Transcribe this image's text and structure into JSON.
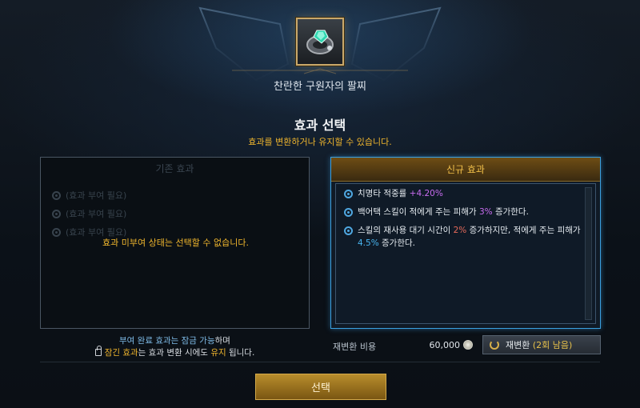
{
  "item": {
    "name": "찬란한 구원자의 팔찌",
    "icon": "bracelet-gem-icon"
  },
  "section": {
    "title": "효과 선택",
    "subtitle": "효과를 변환하거나 유지할 수 있습니다."
  },
  "left_panel": {
    "header": "기존 효과",
    "rows": [
      "(효과 부여 필요)",
      "(효과 부여 필요)",
      "(효과 부여 필요)"
    ],
    "notice": "효과 미부여 상태는 선택할 수 없습니다."
  },
  "right_panel": {
    "header": "신규 효과",
    "effects": [
      {
        "pre": "치명타 적중률 ",
        "val": "+4.20%",
        "post": "",
        "val2": "",
        "post2": ""
      },
      {
        "pre": "백어택 스킬이 적에게 주는 피해가 ",
        "val": "3%",
        "post": " 증가한다.",
        "val2": "",
        "post2": ""
      },
      {
        "pre": "스킬의 재사용 대기 시간이 ",
        "val": "2%",
        "post": " 증가하지만, 적에게 주는 피해가 ",
        "val2": "4.5%",
        "post2": " 증가한다."
      }
    ]
  },
  "info": {
    "line1_a": "부여 완료 효과는 잠금 가능",
    "line1_b": "하며",
    "line2_a": "잠긴 효과",
    "line2_b": "는 효과 변환 시에도 ",
    "line2_c": "유지",
    "line2_d": " 됩니다."
  },
  "cost": {
    "label": "재변환 비용",
    "value": "60,000"
  },
  "reroll": {
    "label": "재변환",
    "remaining": "(2회 남음)"
  },
  "select_button": "선택",
  "colors": {
    "gold": "#f0b62d",
    "accent_blue": "#3aa0e0",
    "purple": "#c86cf0",
    "red": "#e66a5a"
  }
}
